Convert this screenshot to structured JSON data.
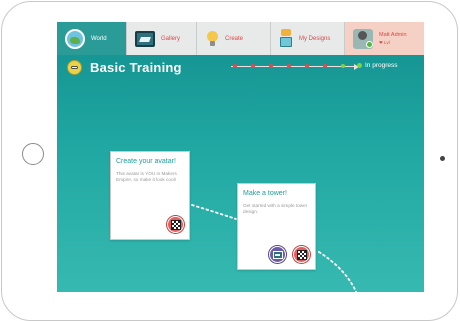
{
  "nav": {
    "tabs": [
      {
        "label": "World",
        "icon": "globe-icon"
      },
      {
        "label": "Gallery",
        "icon": "gallery-icon"
      },
      {
        "label": "Create",
        "icon": "lightbulb-icon"
      },
      {
        "label": "My Designs",
        "icon": "robot-icon"
      }
    ],
    "user": {
      "name": "Matt Admin",
      "level": "❤ Lvl"
    }
  },
  "page": {
    "title": "Basic Training",
    "status": "In progress",
    "progress_steps_total": 7,
    "progress_steps_done": 6
  },
  "cards": [
    {
      "title": "Create your avatar!",
      "description": "This avatar is YOU in Makers Empire, so make it look cool!"
    },
    {
      "title": "Make a tower!",
      "description": "Get started with a simple tower design."
    }
  ],
  "colors": {
    "accent": "#1e9e9b",
    "tab_text": "#d64a4a",
    "progress_done": "#e34a4a",
    "progress_current": "#7bd63d"
  }
}
